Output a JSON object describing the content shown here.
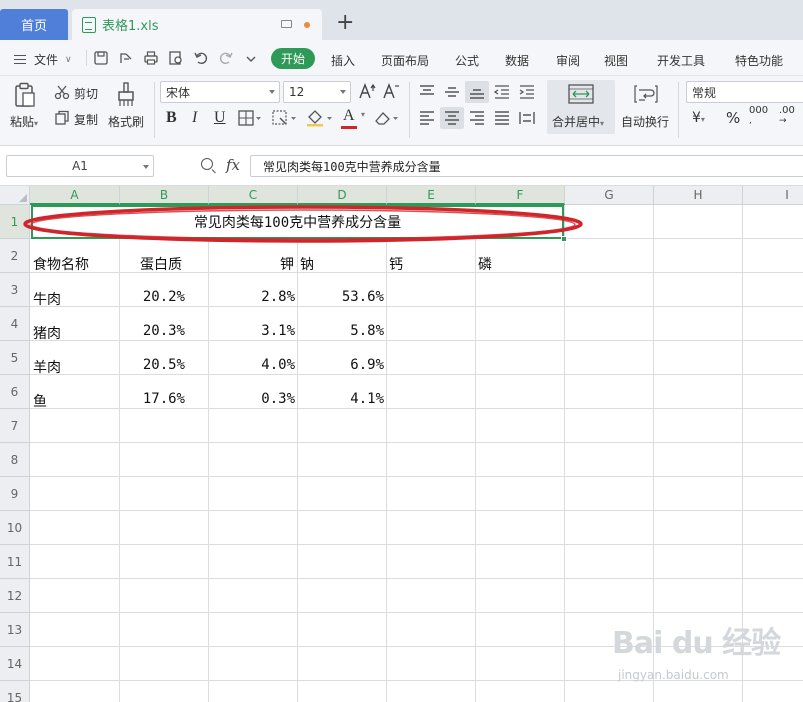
{
  "tabs": {
    "home": "首页",
    "file": "表格1.xls",
    "add": "+"
  },
  "menu": {
    "file": "文件",
    "items": [
      "开始",
      "插入",
      "页面布局",
      "公式",
      "数据",
      "审阅",
      "视图",
      "开发工具",
      "特色功能"
    ]
  },
  "ribbon": {
    "paste": "粘贴",
    "cut": "剪切",
    "copy": "复制",
    "format_painter": "格式刷",
    "font_name": "宋体",
    "font_size": "12",
    "bold": "B",
    "italic": "I",
    "underline": "U",
    "font_color": "A",
    "merge_center": "合并居中",
    "wrap_text": "自动换行",
    "number_format": "常规",
    "currency": "¥",
    "percent": "%",
    "thousands": "000",
    "increase_decimal": ".00"
  },
  "formula_bar": {
    "cell_ref": "A1",
    "fx": "fx",
    "content": "常见肉类每100克中营养成分含量"
  },
  "columns": [
    "A",
    "B",
    "C",
    "D",
    "E",
    "F",
    "G",
    "H",
    "I"
  ],
  "rows": [
    "1",
    "2",
    "3",
    "4",
    "5",
    "6",
    "7",
    "8",
    "9",
    "10",
    "11",
    "12",
    "13",
    "14",
    "15"
  ],
  "sheet": {
    "title": "常见肉类每100克中营养成分含量",
    "headers": [
      "食物名称",
      "蛋白质",
      "钾",
      "钠",
      "钙",
      "磷"
    ],
    "data": [
      [
        "牛肉",
        "20.2%",
        "2.8%",
        "53.6%"
      ],
      [
        "猪肉",
        "20.3%",
        "3.1%",
        "5.8%"
      ],
      [
        "羊肉",
        "20.5%",
        "4.0%",
        "6.9%"
      ],
      [
        "鱼",
        "17.6%",
        "0.3%",
        "4.1%"
      ]
    ]
  },
  "watermark": {
    "logo": "Bai du 经验",
    "sub": "jingyan.baidu.com"
  },
  "colors": {
    "accent": "#2f9a58",
    "tab_blue": "#4f7fd8",
    "annotation_red": "#d0262b"
  }
}
